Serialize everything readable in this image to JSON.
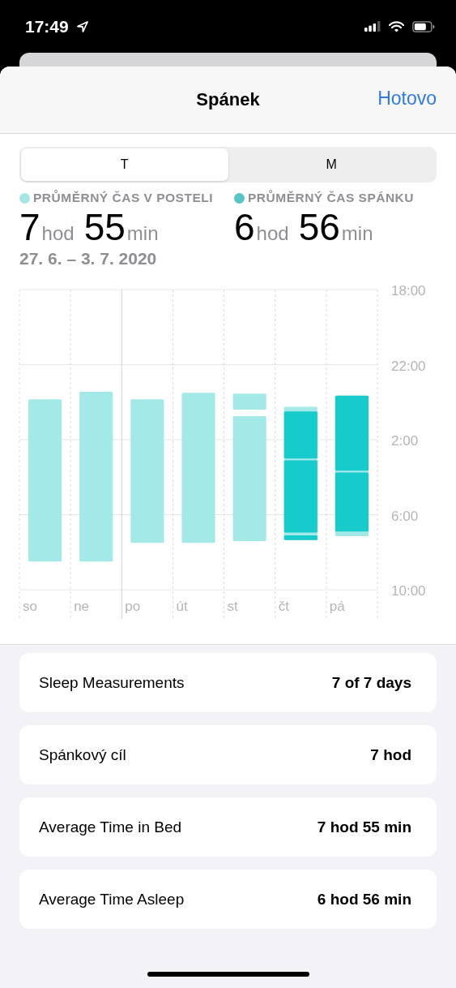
{
  "status_bar": {
    "time": "17:49"
  },
  "nav": {
    "title": "Spánek",
    "done": "Hotovo"
  },
  "segments": [
    {
      "label": "T",
      "selected": true
    },
    {
      "label": "M",
      "selected": false
    }
  ],
  "summary": [
    {
      "label": "PRŮMĚRNÝ ČAS V POSTELI",
      "color": "#a4e6e4",
      "hours": "7",
      "hours_unit": "hod",
      "minutes": "55",
      "minutes_unit": "min"
    },
    {
      "label": "PRŮMĚRNÝ ČAS SPÁNKU",
      "color": "#56c6c5",
      "hours": "6",
      "hours_unit": "hod",
      "minutes": "56",
      "minutes_unit": "min"
    }
  ],
  "date_range": "27. 6. – 3. 7. 2020",
  "sleep_chart": {
    "time_labels": [
      "18:00",
      "22:00",
      "2:00",
      "6:00",
      "10:00"
    ],
    "day_labels": [
      "so",
      "ne",
      "po",
      "út",
      "st",
      "čt",
      "pá"
    ]
  },
  "rows": [
    {
      "label": "Sleep Measurements",
      "value": "7 of 7 days"
    },
    {
      "label": "Spánkový cíl",
      "value": "7 hod"
    },
    {
      "label": "Average Time in Bed",
      "value": "7 hod 55 min"
    },
    {
      "label": "Average Time Asleep",
      "value": "6 hod 56 min"
    }
  ]
}
